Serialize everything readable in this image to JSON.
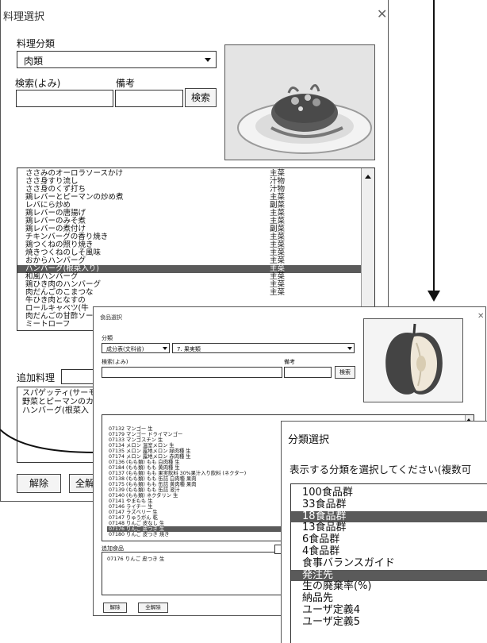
{
  "dish_dialog": {
    "title": "料理選択",
    "category_label": "料理分類",
    "category_value": "肉類",
    "search_label": "検索(よみ)",
    "note_label": "備考",
    "search_button": "検索",
    "dishes": [
      {
        "name": "ささみのオーロラソースかけ",
        "type": "主菜"
      },
      {
        "name": "ささ身すり流し",
        "type": "汁物"
      },
      {
        "name": "ささ身のくず打ち",
        "type": "汁物"
      },
      {
        "name": "鶏レバーとピーマンの炒め煮",
        "type": "主菜"
      },
      {
        "name": "レバにら炒め",
        "type": "副菜"
      },
      {
        "name": "鶏レバーの唐揚げ",
        "type": "主菜"
      },
      {
        "name": "鶏レバーのみそ煮",
        "type": "主菜"
      },
      {
        "name": "鶏レバーの煮付け",
        "type": "副菜"
      },
      {
        "name": "チキンバーグの香り焼き",
        "type": "主菜"
      },
      {
        "name": "鶏つくねの照り焼き",
        "type": "主菜"
      },
      {
        "name": "焼きつくねのしそ風味",
        "type": "主菜"
      },
      {
        "name": "おからハンバーグ",
        "type": "主菜"
      },
      {
        "name": "ハンバーグ(根菜入り)",
        "type": "主菜",
        "selected": true
      },
      {
        "name": "和風ハンバーグ",
        "type": "主菜"
      },
      {
        "name": "鶏ひき肉のハンバーグ",
        "type": "主菜"
      },
      {
        "name": "肉だんごのこまつな",
        "type": "主菜"
      },
      {
        "name": "牛ひき肉となすの",
        "type": ""
      },
      {
        "name": "ロールキャベツ(牛",
        "type": ""
      },
      {
        "name": "肉だんごの甘酢ソー",
        "type": ""
      },
      {
        "name": "ミートローフ",
        "type": ""
      }
    ],
    "add_label": "追加料理",
    "added_items": [
      "スパゲッティ(サーモ",
      "野菜とピーマンのカ",
      "ハンバーグ(根菜入"
    ],
    "delete_button": "解除",
    "delete_all_button": "全解"
  },
  "food_dialog": {
    "title": "食品選択",
    "category_label": "分類",
    "category_value": "成分表(文科省)",
    "group_value": "7. 果実類",
    "search_label": "検索(よみ)",
    "note_label": "備考",
    "search_button": "検索",
    "foods": [
      "07132 マンゴー 生",
      "07179 マンゴー ドライマンゴー",
      "07133 マンゴスチン 生",
      "07134 メロン 温室メロン 生",
      "07135 メロン 露地メロン 緑肉種 生",
      "07174 メロン 露地メロン 赤肉種 生",
      "07136 (もも類) もも 白肉種 生",
      "07184 (もも類) もも 黄肉種 生",
      "07137 (もも類) もも 果実飲料 30%果汁入り飲料 (ネクター)",
      "07138 (もも類) もも 缶詰 白肉種 果肉",
      "07175 (もも類) もも 缶詰 黄肉種 果肉",
      "07139 (もも類) もも 缶詰 液汁",
      "07140 (もも類) ネクタリン 生",
      "07141 やまもも 生",
      "07146 ライチー 生",
      "07147 ラズベリー 生",
      "07147 りゅうがん 乾",
      "07148 りんご 皮なし 生",
      "07176 りんご 皮つき 生",
      "07180 りんご 皮つき 焼き"
    ],
    "selected_index": 18,
    "added_label": "追加食品",
    "added_items": [
      "07176 りんご 皮つき 生"
    ],
    "delete_button": "解除",
    "delete_all_button": "全解除"
  },
  "group_dialog": {
    "title": "分類選択",
    "prompt": "表示する分類を選択してください(複数可",
    "groups": [
      {
        "label": "100食品群",
        "selected": false
      },
      {
        "label": "33食品群",
        "selected": false
      },
      {
        "label": "18食品群",
        "selected": true
      },
      {
        "label": "13食品群",
        "selected": false
      },
      {
        "label": "6食品群",
        "selected": false
      },
      {
        "label": "4食品群",
        "selected": false
      },
      {
        "label": "食事バランスガイド",
        "selected": false
      },
      {
        "label": "発注先",
        "selected": true
      },
      {
        "label": "生の廃棄率(%)",
        "selected": false
      },
      {
        "label": "納品先",
        "selected": false
      },
      {
        "label": "ユーザ定義4",
        "selected": false
      },
      {
        "label": "ユーザ定義5",
        "selected": false
      }
    ]
  },
  "colors": {
    "selection": "#5a5a5a",
    "border": "#333333",
    "window_bg": "#ffffff"
  }
}
